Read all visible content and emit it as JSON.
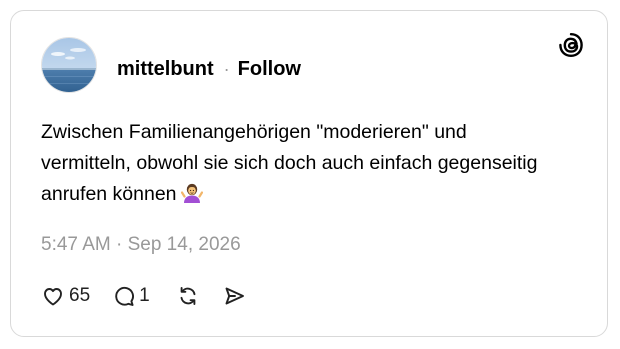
{
  "post": {
    "username": "mittelbunt",
    "separator": "·",
    "follow_label": "Follow",
    "text": "Zwischen Familienangehörigen \"moderieren\" und vermitteln, obwohl sie sich doch auch einfach gegenseitig anrufen können",
    "emoji": "person-shrugging-emoji",
    "timestamp": "5:47 AM · Sep 14, 2026"
  },
  "actions": {
    "likes": "65",
    "replies": "1"
  },
  "icons": {
    "logo": "threads-logo-icon",
    "like": "heart-icon",
    "reply": "comment-icon",
    "repost": "repost-icon",
    "share": "send-icon"
  },
  "colors": {
    "text": "#000000",
    "muted": "#999999",
    "border": "#d9d9d9",
    "emoji_shirt": "#a24fd4"
  }
}
